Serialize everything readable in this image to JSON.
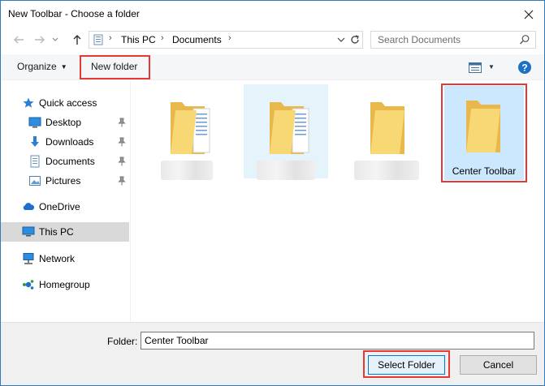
{
  "window": {
    "title": "New Toolbar - Choose a folder"
  },
  "address": {
    "crumbs": [
      "This PC",
      "Documents"
    ]
  },
  "search": {
    "placeholder": "Search Documents"
  },
  "commands": {
    "organize": "Organize",
    "new_folder": "New folder"
  },
  "sidebar": {
    "items": [
      {
        "label": "Quick access",
        "icon": "star-icon"
      },
      {
        "label": "Desktop",
        "icon": "desktop-icon",
        "pinned": true
      },
      {
        "label": "Downloads",
        "icon": "download-arrow-icon",
        "pinned": true
      },
      {
        "label": "Documents",
        "icon": "documents-icon",
        "pinned": true
      },
      {
        "label": "Pictures",
        "icon": "pictures-icon",
        "pinned": true
      },
      {
        "label": "OneDrive",
        "icon": "cloud-icon"
      },
      {
        "label": "This PC",
        "icon": "computer-icon",
        "selected": true
      },
      {
        "label": "Network",
        "icon": "network-icon"
      },
      {
        "label": "Homegroup",
        "icon": "homegroup-icon"
      }
    ]
  },
  "folders": [
    {
      "label": "",
      "icon": "folder-with-documents-icon"
    },
    {
      "label": "",
      "icon": "folder-with-documents-icon",
      "hover": true
    },
    {
      "label": "",
      "icon": "folder-icon"
    },
    {
      "label": "Center Toolbar",
      "icon": "folder-icon",
      "selected": true
    }
  ],
  "footer": {
    "folder_label": "Folder:",
    "folder_value": "Center Toolbar",
    "select_label": "Select Folder",
    "cancel_label": "Cancel"
  },
  "colors": {
    "accent": "#0078d7",
    "highlight_box": "#e53935",
    "folder": "#f8d775"
  }
}
